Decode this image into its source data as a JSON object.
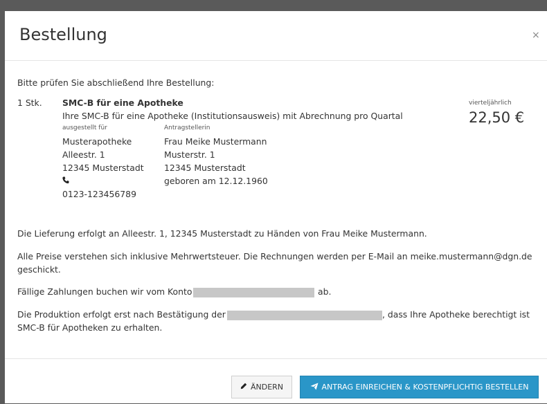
{
  "dialog": {
    "title": "Bestellung",
    "close_glyph": "×"
  },
  "intro": "Bitte prüfen Sie abschließend Ihre Bestellung:",
  "item": {
    "quantity": "1 Stk.",
    "name": "SMC-B für eine Apotheke",
    "description": "Ihre SMC-B für eine Apotheke (Institutionsausweis) mit Abrechnung pro Quartal",
    "billing_period": "vierteljährlich",
    "price": "22,50 €"
  },
  "issued_for": {
    "label": "ausgestellt für",
    "name": "Musterapotheke",
    "street": "Alleestr. 1",
    "city": "12345 Musterstadt",
    "phone_icon": "phone-icon",
    "phone": "0123-123456789"
  },
  "applicant": {
    "label": "Antragstellerin",
    "name": "Frau Meike Mustermann",
    "street": "Musterstr. 1",
    "city": "12345 Musterstadt",
    "birth": "geboren am 12.12.1960"
  },
  "delivery_text": "Die Lieferung erfolgt an Alleestr. 1, 12345 Musterstadt zu Händen von Frau Meike Mustermann.",
  "prices_text_line1": "Alle Preise verstehen sich inklusive Mehrwertsteuer. Die Rechnungen werden per E-Mail an meike.mustermann@dgn.de",
  "prices_text_line2": "geschickt.",
  "payment_text_before": "Fällige Zahlungen buchen wir vom Konto",
  "payment_text_after": "ab.",
  "production_text_before": "Die Produktion erfolgt erst nach Bestätigung der",
  "production_text_after": ", dass Ihre Apotheke berechtigt ist",
  "production_text_line2": "SMC-B für Apotheken zu erhalten.",
  "buttons": {
    "edit_label": "ÄNDERN",
    "edit_icon": "pencil-icon",
    "submit_label": "ANTRAG EINREICHEN & KOSTENPFLICHTIG BESTELLEN",
    "submit_icon": "paper-plane-icon"
  },
  "colors": {
    "primary": "#2a96c8",
    "backdrop": "#5a5a5a",
    "redaction": "#c7c7c7"
  }
}
